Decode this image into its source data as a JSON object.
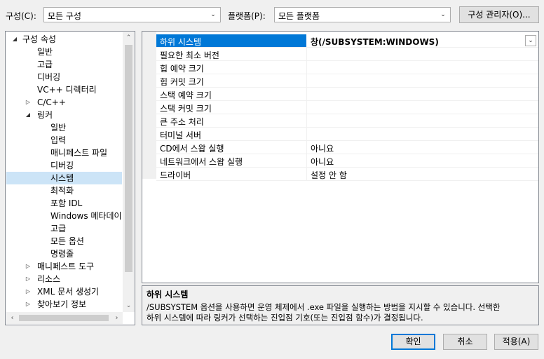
{
  "toolbar": {
    "config_label": "구성(C):",
    "config_value": "모든 구성",
    "platform_label": "플랫폼(P):",
    "platform_value": "모든 플랫폼",
    "config_manager_button": "구성 관리자(O)..."
  },
  "tree": {
    "root": "구성 속성",
    "items": [
      "일반",
      "고급",
      "디버깅",
      "VC++ 디렉터리",
      "C/C++",
      "링커",
      "일반",
      "입력",
      "매니페스트 파일",
      "디버깅",
      "시스템",
      "최적화",
      "포함 IDL",
      "Windows 메타데이",
      "고급",
      "모든 옵션",
      "명령줄",
      "매니페스트 도구",
      "리소스",
      "XML 문서 생성기",
      "찾아보기 정보"
    ]
  },
  "properties": {
    "rows": [
      {
        "name": "하위 시스템",
        "value": "창(/SUBSYSTEM:WINDOWS)"
      },
      {
        "name": "필요한 최소 버전",
        "value": ""
      },
      {
        "name": "힙 예약 크기",
        "value": ""
      },
      {
        "name": "힙 커밋 크기",
        "value": ""
      },
      {
        "name": "스택 예약 크기",
        "value": ""
      },
      {
        "name": "스택 커밋 크기",
        "value": ""
      },
      {
        "name": "큰 주소 처리",
        "value": ""
      },
      {
        "name": "터미널 서버",
        "value": ""
      },
      {
        "name": "CD에서 스왑 실행",
        "value": "아니요"
      },
      {
        "name": "네트워크에서 스왑 실행",
        "value": "아니요"
      },
      {
        "name": "드라이버",
        "value": "설정 안 함"
      }
    ]
  },
  "description": {
    "title": "하위 시스템",
    "line1": "/SUBSYSTEM 옵션을 사용하면 운영 체제에서 .exe 파일을 실행하는 방법을 지시할 수 있습니다. 선택한",
    "line2": "하위 시스템에 따라 링커가 선택하는 진입점 기호(또는 진입점 함수)가 결정됩니다."
  },
  "buttons": {
    "ok": "확인",
    "cancel": "취소",
    "apply": "적용(A)"
  }
}
